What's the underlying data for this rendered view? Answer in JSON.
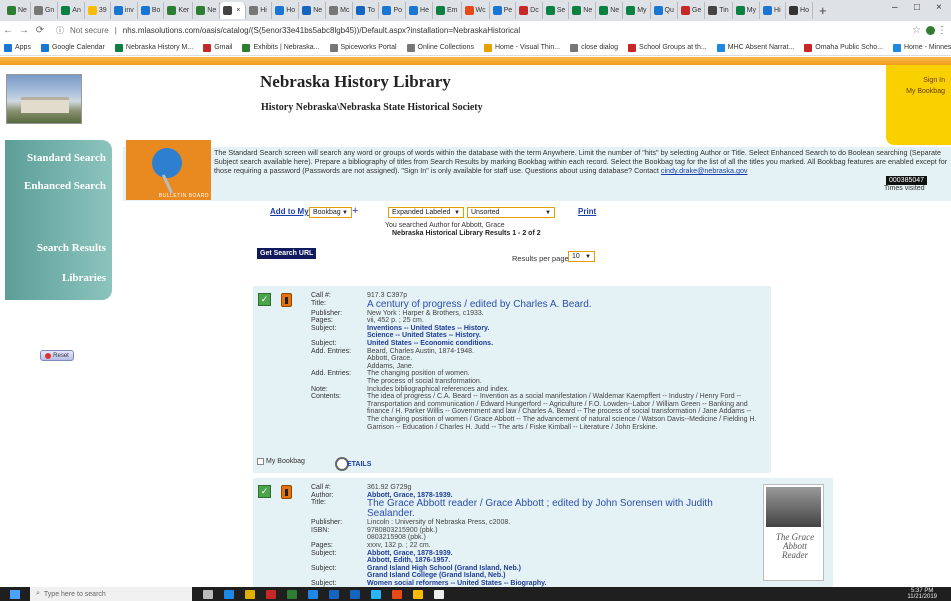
{
  "browser": {
    "tabs": [
      {
        "label": "Ne",
        "color": "#2e7d32"
      },
      {
        "label": "Gn",
        "color": "#777"
      },
      {
        "label": "An",
        "color": "#0b8043"
      },
      {
        "label": "39",
        "color": "#fbbc04"
      },
      {
        "label": "inv",
        "color": "#1976d2"
      },
      {
        "label": "Bo",
        "color": "#1976d2"
      },
      {
        "label": "Ker",
        "color": "#2e7d32"
      },
      {
        "label": "Ne",
        "color": "#2e7d32"
      },
      {
        "label": "",
        "color": "#444",
        "active": true
      },
      {
        "label": "Hi",
        "color": "#777"
      },
      {
        "label": "Ho",
        "color": "#1976d2"
      },
      {
        "label": "Ne",
        "color": "#1565c0"
      },
      {
        "label": "Mc",
        "color": "#777"
      },
      {
        "label": "To",
        "color": "#1565c0"
      },
      {
        "label": "Po",
        "color": "#1976d2"
      },
      {
        "label": "He",
        "color": "#1976d2"
      },
      {
        "label": "Em",
        "color": "#0b8043"
      },
      {
        "label": "Wc",
        "color": "#e64a19"
      },
      {
        "label": "Pe",
        "color": "#1976d2"
      },
      {
        "label": "Dc",
        "color": "#c62828"
      },
      {
        "label": "Se",
        "color": "#0b8043"
      },
      {
        "label": "Ne",
        "color": "#0b8043"
      },
      {
        "label": "Ne",
        "color": "#0b8043"
      },
      {
        "label": "My",
        "color": "#0b8043"
      },
      {
        "label": "Qu",
        "color": "#1976d2"
      },
      {
        "label": "Ge",
        "color": "#c62828"
      },
      {
        "label": "Tin",
        "color": "#444"
      },
      {
        "label": "My",
        "color": "#0b8043"
      },
      {
        "label": "Hi",
        "color": "#1976d2"
      },
      {
        "label": "Ho",
        "color": "#333"
      }
    ],
    "new_tab": "+",
    "window_controls": {
      "minimize": "–",
      "maximize": "□",
      "close": "×"
    },
    "not_secure": "Not secure",
    "url": "nhs.mlasolutions.com/oasis/catalog/(S(5enor33e41bs5abc8lgb45))/Default.aspx?installation=NebraskaHistorical",
    "bookmarks": [
      {
        "label": "Apps",
        "color": "#1976d2"
      },
      {
        "label": "Google Calendar",
        "color": "#1976d2"
      },
      {
        "label": "Nebraska History M...",
        "color": "#0b8043"
      },
      {
        "label": "Gmail",
        "color": "#c62828"
      },
      {
        "label": "Exhibits | Nebraska...",
        "color": "#2e7d32"
      },
      {
        "label": "Spiceworks Portal",
        "color": "#777"
      },
      {
        "label": "Online Collections",
        "color": "#777"
      },
      {
        "label": "Home - Visual Thin...",
        "color": "#e6a000"
      },
      {
        "label": "close dialog",
        "color": "#777"
      },
      {
        "label": "School Groups at th...",
        "color": "#c62828"
      },
      {
        "label": "MHC Absent Narrat...",
        "color": "#1e88e5"
      },
      {
        "label": "Omaha Public Scho...",
        "color": "#c62828"
      },
      {
        "label": "Home - Minnesota...",
        "color": "#1e88e5"
      },
      {
        "label": "Nebraska History In...",
        "color": "#2e7d32"
      }
    ]
  },
  "site": {
    "title": "Nebraska History Library",
    "subtitle": "History Nebraska\\Nebraska State Historical Society",
    "sign_in": "Sign In",
    "my_bookbag": "My Bookbag",
    "board_label": "BULLETIN BOARD"
  },
  "nav": {
    "standard_search": "Standard Search",
    "enhanced_search": "Enhanced Search",
    "search_results": "Search Results",
    "libraries": "Libraries",
    "reset": "Reset"
  },
  "info": {
    "text": "The Standard Search screen will search any word or groups of words within the database with the term Anywhere. Limit the number of \"hits\" by selecting Author or Title. Select Enhanced Search to do Boolean searching (Separate Subject search available here). Prepare a bibliography of titles from Search Results by marking Bookbag within each record. Select the Bookbag tag for the list of all the titles you marked. All Bookbag features are enabled except for those requiring a password (Passwords are not assigned). \"Sign In\" is only available for staff use. Questions about using database? Contact ",
    "contact_email": "cindy.drake@nebraska.gov",
    "counter": "000385047",
    "times_visited": "Times visited"
  },
  "controls": {
    "add_to_my": "Add to My",
    "bookbag_select": "Bookbag",
    "plus": "+",
    "format_select": "Expanded Labeled",
    "sort_select": "Unsorted",
    "print": "Print",
    "searched_for": "You searched Author for Abbott, Grace",
    "results_heading": "Nebraska Historical Library Results 1 - 2 of 2",
    "get_search_url": "Get Search URL",
    "results_per_page_label": "Results per page",
    "results_per_page_value": "10"
  },
  "records": [
    {
      "fields": [
        {
          "k": "Call #:",
          "v": "917.3 C397p"
        },
        {
          "k": "Title:",
          "v": "A century of progress / edited by Charles A. Beard.",
          "style": "title"
        },
        {
          "k": "Publisher:",
          "v": "New York : Harper & Brothers, c1933."
        },
        {
          "k": "Pages:",
          "v": "vii, 452 p. ; 25 cm."
        },
        {
          "k": "Subject:",
          "v": "Inventions -- United States -- History.",
          "style": "subject"
        },
        {
          "k": "",
          "v": "Science -- United States -- History.",
          "style": "subject"
        },
        {
          "k": "Subject:",
          "v": "United States -- Economic conditions.",
          "style": "subject"
        },
        {
          "k": "Add. Entries:",
          "v": "Beard, Charles Austin, 1874-1948."
        },
        {
          "k": "",
          "v": "Abbott, Grace."
        },
        {
          "k": "",
          "v": "Addams, Jane."
        },
        {
          "k": "Add. Entries:",
          "v": "The changing position of women."
        },
        {
          "k": "",
          "v": "The process of social transformation."
        },
        {
          "k": "Note:",
          "v": "Includes bibliographical references and index."
        },
        {
          "k": "Contents:",
          "v": "The idea of progress / C.A. Beard -- Invention as a social manifestation / Waldemar Kaempffert -- Industry / Henry Ford -- Transportation and communication / Edward Hungerford -- Agriculture / F.O. Lowden--Labor / William Green -- Banking and finance / H. Parker Willis -- Government and law / Charles A. Beard -- The process of social transformation / Jane Addams -- The changing position of women / Grace Abbott -- The advancement of natural science / Watson Davis--Medicine / Fielding H. Garrison -- Education / Charles H. Judd -- The arts / Fiske Kimball -- Literature / John Erskine."
        }
      ],
      "my_bookbag": "My Bookbag",
      "details": "ETAILS"
    },
    {
      "fields": [
        {
          "k": "Call #:",
          "v": "361.92 G729g"
        },
        {
          "k": "Author:",
          "v": "Abbott, Grace, 1878-1939.",
          "style": "subject"
        },
        {
          "k": "Title:",
          "v": "The Grace Abbott reader / Grace Abbott ; edited by John Sorensen with Judith Sealander.",
          "style": "title"
        },
        {
          "k": "Publisher:",
          "v": "Lincoln : University of Nebraska Press, c2008."
        },
        {
          "k": "ISBN:",
          "v": "9780803215900 (pbk.)"
        },
        {
          "k": "",
          "v": "0803215908 (pbk.)"
        },
        {
          "k": "Pages:",
          "v": "xxxv, 132 p. ; 22 cm."
        },
        {
          "k": "Subject:",
          "v": "Abbott, Grace, 1878-1939.",
          "style": "subject"
        },
        {
          "k": "",
          "v": "Abbott, Edith, 1876-1957.",
          "style": "subject"
        },
        {
          "k": "Subject:",
          "v": "Grand Island High School (Grand Island, Neb.)",
          "style": "subject"
        },
        {
          "k": "",
          "v": "Grand Island College (Grand Island, Neb.)",
          "style": "subject"
        },
        {
          "k": "Subject:",
          "v": "Women social reformers -- United States -- Biography.",
          "style": "subject"
        }
      ],
      "cover_text": "The Grace Abbott Reader"
    }
  ],
  "taskbar": {
    "search_placeholder": "Type here to search",
    "time": "5:37 PM",
    "date": "11/21/2019"
  }
}
